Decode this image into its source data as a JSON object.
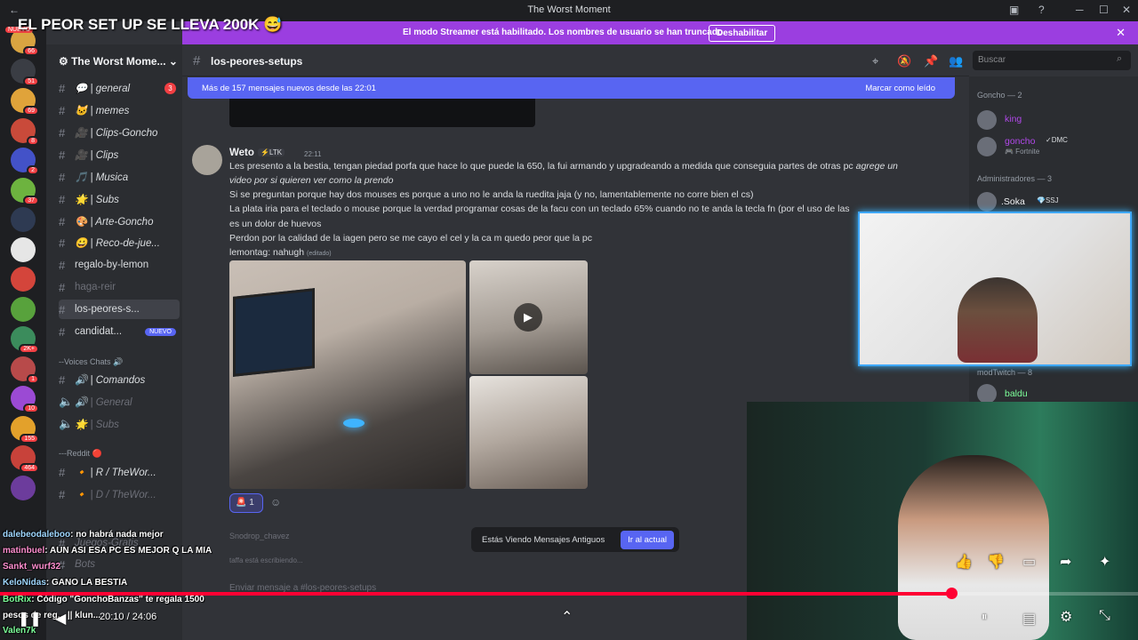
{
  "window": {
    "title": "The Worst Moment",
    "controls": [
      "─",
      "☐",
      "✕"
    ]
  },
  "stream_overlay": {
    "title": "EL PEOR SET UP SE LLEVA 200K 😅"
  },
  "banner": {
    "message": "El modo Streamer está habilitado. Los nombres de usuario se han truncado.",
    "button": "Deshabilitar"
  },
  "server_rail": {
    "items": [
      {
        "badge": "66",
        "color": "#d9a441"
      },
      {
        "badge": "51",
        "color": "#3a3d44"
      },
      {
        "badge": "69",
        "color": "#e0a33a"
      },
      {
        "badge": "8",
        "color": "#c94a3a"
      },
      {
        "badge": "2",
        "color": "#4352c8"
      },
      {
        "badge": "37",
        "color": "#6db33f"
      },
      {
        "badge": "",
        "color": "#2e3a52"
      },
      {
        "badge": "",
        "color": "#e6e6e6"
      },
      {
        "badge": "",
        "color": "#d4453b"
      },
      {
        "badge": "",
        "color": "#58a23c"
      },
      {
        "badge": "2K+",
        "color": "#3b8c5c"
      },
      {
        "badge": "1",
        "color": "#b84a4a"
      },
      {
        "badge": "10",
        "color": "#9b4ad4"
      },
      {
        "badge": "155",
        "color": "#e3a12b"
      },
      {
        "badge": "464",
        "color": "#c8423a"
      },
      {
        "badge": "",
        "color": "#6c3c9c"
      }
    ],
    "new_label": "NUEVO"
  },
  "sidebar": {
    "server_name": "The Worst Mome...",
    "channels": [
      {
        "label": "💬 | general",
        "count": "3"
      },
      {
        "label": "🐱 | memes"
      },
      {
        "label": "🎥 | Clips-Goncho"
      },
      {
        "label": "🎥 | Clips"
      },
      {
        "label": "🎵 | Musica"
      },
      {
        "label": "🌟 | Subs"
      },
      {
        "label": "🎨 | Arte-Goncho"
      },
      {
        "label": "😀 | Reco-de-jue..."
      },
      {
        "label": "regalo-by-lemon"
      },
      {
        "label": "haga-reir"
      },
      {
        "label": "los-peores-s..."
      },
      {
        "label": "candidat...",
        "pill": "NUEVO"
      }
    ],
    "voice_category": "--Voices Chats 🔊",
    "voice_channels": [
      {
        "label": "🔊 | Comandos"
      },
      {
        "label": "🔊 | General"
      },
      {
        "label": "🌟 | Subs"
      }
    ],
    "reddit_category": "---Reddit 🔴",
    "reddit_channels": [
      {
        "label": "🔸 | R / TheWor..."
      },
      {
        "label": "🔸 | D / TheWor..."
      },
      {
        "label": "Juegos-Gratis"
      },
      {
        "label": "Bots"
      }
    ]
  },
  "header": {
    "channel": "los-peores-setups"
  },
  "search": {
    "placeholder": "Buscar"
  },
  "new_messages_bar": {
    "text": "Más de 157 mensajes nuevos desde las 22:01",
    "action": "Marcar como leído"
  },
  "message": {
    "author": "Weto",
    "tag": "⚡LTK",
    "time": "22:11",
    "lines": [
      "Les presento a la bestia, tengan piedad porfa que hace lo que puede la 650, la fui armando y upgradeando a medida que conseguia partes de otras pc",
      "video por si quieren ver como la prendo",
      "Si se preguntan porque hay dos mouses es porque a uno no le anda la ruedita jaja (y no, lamentablemente no corre bien el cs)",
      "La plata iria para el teclado o mouse porque la verdad programar  cosas de la facu con un teclado 65% cuando no te anda la tecla fn (por el uso de las flechitas)",
      "es un dolor de huevos",
      "Perdon por la calidad de la iagen pero se me cayo el cel y la ca m quedo peor que la pc",
      "lemontag: nahugh"
    ],
    "italic_tail": "agrege un",
    "edited": "(editado)",
    "reaction_count": "1"
  },
  "jump_bar": {
    "text": "Estás Viendo Mensajes Antiguos",
    "button": "Ir al actual"
  },
  "typing": {
    "user": "Snodrop_chavez",
    "text": "taffa está escribiendo..."
  },
  "composer": {
    "placeholder": "Enviar mensaje a #los-peores-setups"
  },
  "members": {
    "cat1": "Goncho — 2",
    "m1": "king",
    "m2": "goncho",
    "m2_tag": "✓DMC",
    "m2_status": "🎮 Fortnite",
    "cat2": "Administradores — 3",
    "m3": ".Soka",
    "m3_tag": "💎SSJ",
    "cat3": "modTwitch — 8",
    "m4": "baldu"
  },
  "chat_overlay": [
    {
      "user": "dalebeodaleboo",
      "text": ": no habrá nada mejor"
    },
    {
      "user": "matinbuel",
      "text": ": AUN ASI ESA PC ES MEJOR Q LA MIA"
    },
    {
      "user": "Sankt_wurf32",
      "text": ""
    },
    {
      "user": "KeloNidas",
      "text": ": GANO LA BESTIA"
    },
    {
      "user": "BotRix",
      "text": ": Código \"GonchoBanzas\" te regala 1500"
    },
    {
      "user": "pesos de reg...",
      "text": "|| klun..."
    },
    {
      "user": "Valen7k",
      "text": ""
    }
  ],
  "player": {
    "timecode": "20:10 / 24:06",
    "progress_fraction": 0.836
  },
  "colors": {
    "accent": "#5865f2",
    "banner": "#9b3ee0",
    "progress": "#ff0033"
  }
}
